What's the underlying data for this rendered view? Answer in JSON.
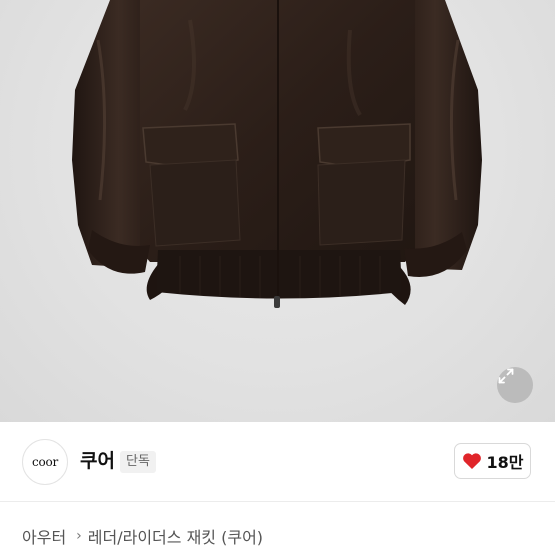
{
  "brand": {
    "logo_text": "coor",
    "name": "쿠어",
    "badge": "단독"
  },
  "like": {
    "count": "18만",
    "color": "#e0252a"
  },
  "breadcrumb": {
    "category": "아우터",
    "subcategory": "레더/라이더스 재킷 (쿠어)"
  },
  "icons": {
    "expand": "expand-arrows-icon",
    "like": "heart-icon",
    "separator": "chevron-right-icon"
  },
  "product_image": {
    "subject": "dark brown leather jacket",
    "background_color": "#e4e4e4"
  }
}
